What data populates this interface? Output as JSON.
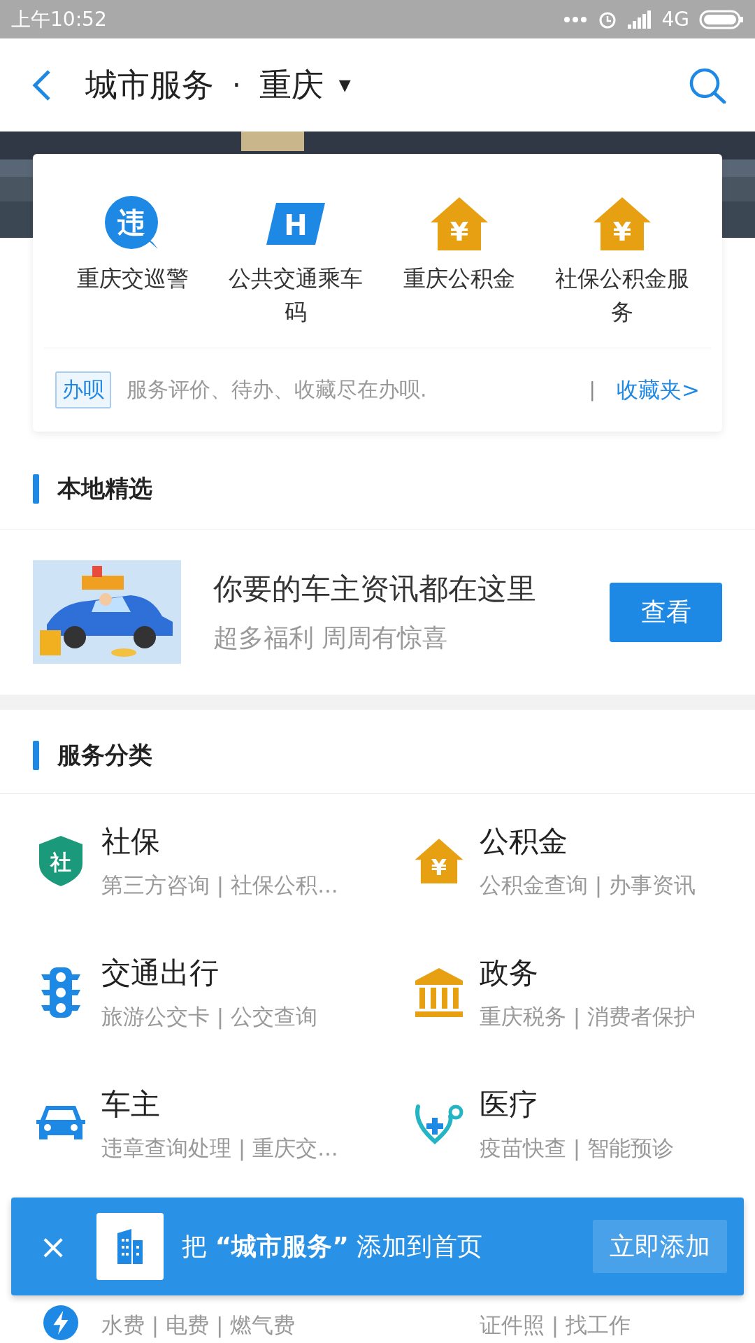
{
  "status_bar": {
    "time": "上午10:52",
    "network": "4G"
  },
  "header": {
    "title": "城市服务",
    "separator": "·",
    "city": "重庆",
    "dropdown": "▼"
  },
  "quick_services": [
    {
      "label": "重庆交巡警",
      "kind": "violation",
      "glyph": "违"
    },
    {
      "label": "公共交通乘车码",
      "kind": "bus",
      "glyph": "H"
    },
    {
      "label": "重庆公积金",
      "kind": "house",
      "glyph": "¥"
    },
    {
      "label": "社保公积金服务",
      "kind": "house",
      "glyph": "¥"
    }
  ],
  "banbei": {
    "tag": "办呗",
    "text": "服务评价、待办、收藏尽在办呗.",
    "divider": "|",
    "link": "收藏夹>"
  },
  "local_picks": {
    "heading": "本地精选",
    "title": "你要的车主资讯都在这里",
    "subtitle": "超多福利  周周有惊喜",
    "button": "查看"
  },
  "categories": {
    "heading": "服务分类",
    "items": [
      {
        "title": "社保",
        "subtitle": "第三方咨询 | 社保公积...",
        "kind": "shield",
        "glyph": "社"
      },
      {
        "title": "公积金",
        "subtitle": "公积金查询 | 办事资讯",
        "kind": "house",
        "glyph": "¥"
      },
      {
        "title": "交通出行",
        "subtitle": "旅游公交卡 | 公交查询",
        "kind": "traffic-light"
      },
      {
        "title": "政务",
        "subtitle": "重庆税务 | 消费者保护",
        "kind": "bank"
      },
      {
        "title": "车主",
        "subtitle": "违章查询处理 | 重庆交...",
        "kind": "car"
      },
      {
        "title": "医疗",
        "subtitle": "疫苗快查 | 智能预诊",
        "kind": "stethoscope"
      },
      {
        "subtitle": "水费 | 电费 | 燃气费",
        "kind": "bolt"
      },
      {
        "subtitle": "证件照 | 找工作"
      }
    ]
  },
  "add_prompt": {
    "close": "×",
    "message": "把 **“城市服务”** 添加到首页",
    "button": "立即添加"
  }
}
